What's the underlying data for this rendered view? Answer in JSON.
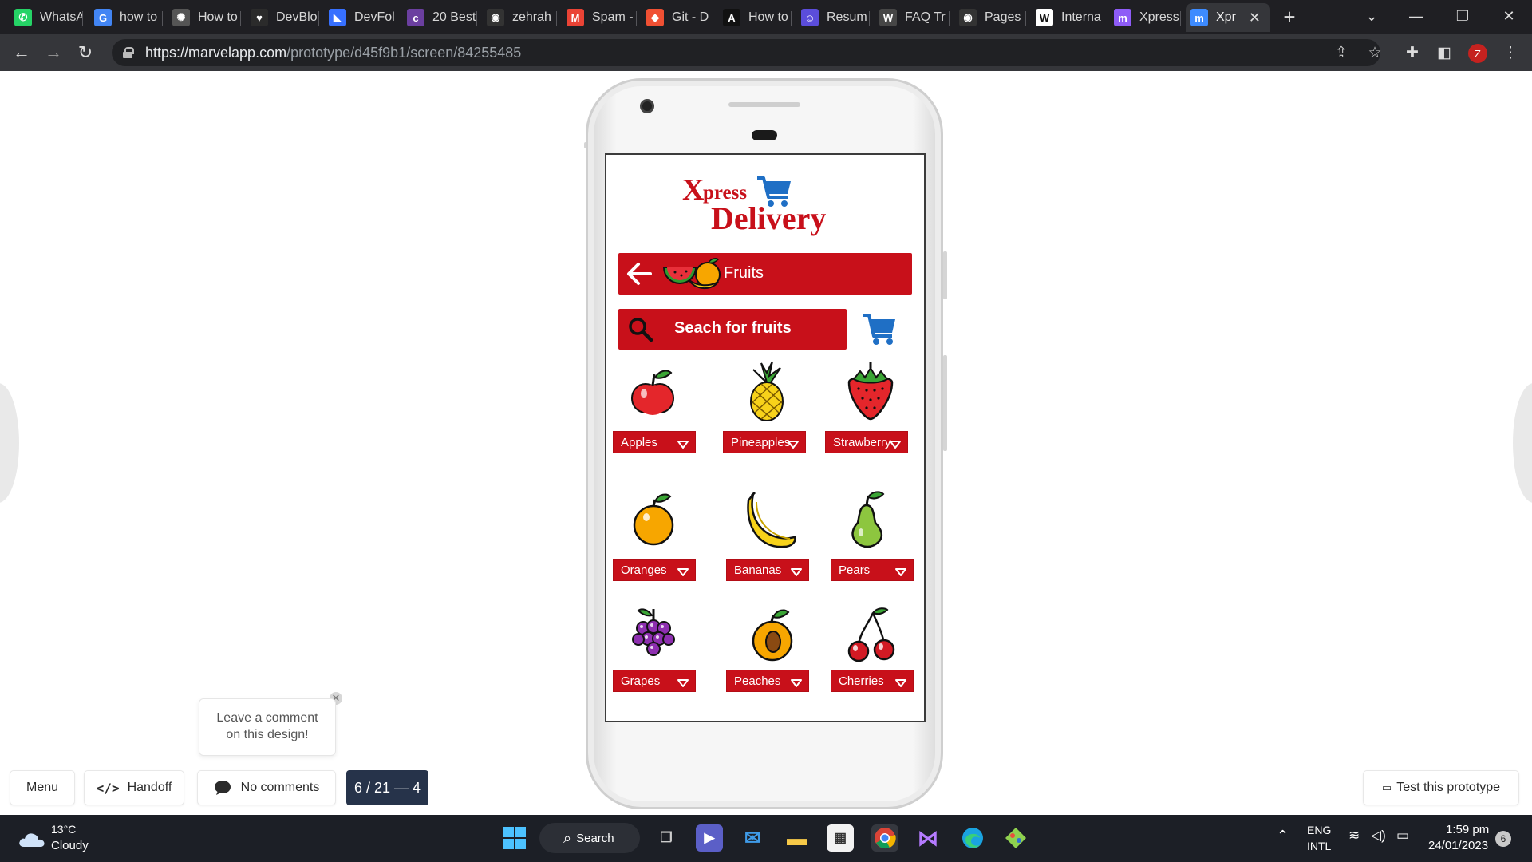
{
  "browser": {
    "tabs": [
      {
        "label": "WhatsA",
        "icon": "whatsapp-icon",
        "color": "#25d366",
        "glyph": "✆"
      },
      {
        "label": "how to",
        "icon": "google-icon",
        "color": "#4285f4",
        "glyph": "G"
      },
      {
        "label": "How to",
        "icon": "openai-icon",
        "color": "#555555",
        "glyph": "✺"
      },
      {
        "label": "DevBlo",
        "icon": "heart-icon",
        "color": "#2b2b2b",
        "glyph": "♥"
      },
      {
        "label": "DevFol",
        "icon": "devfolio-icon",
        "color": "#3770ff",
        "glyph": "◣"
      },
      {
        "label": "20 Best",
        "icon": "colorlib-icon",
        "color": "#6b3fa0",
        "glyph": "c"
      },
      {
        "label": "zehrah",
        "icon": "github-icon",
        "color": "#333333",
        "glyph": "◉"
      },
      {
        "label": "Spam -",
        "icon": "gmail-icon",
        "color": "#ea4335",
        "glyph": "M"
      },
      {
        "label": "Git - D",
        "icon": "git-icon",
        "color": "#f05033",
        "glyph": "◆"
      },
      {
        "label": "How to",
        "icon": "a-icon",
        "color": "#111111",
        "glyph": "A"
      },
      {
        "label": "Resum",
        "icon": "resume-icon",
        "color": "#5b4ddb",
        "glyph": "☺"
      },
      {
        "label": "FAQ Tr",
        "icon": "wordpress-icon",
        "color": "#464646",
        "glyph": "W"
      },
      {
        "label": "Pages",
        "icon": "github-icon",
        "color": "#333333",
        "glyph": "◉"
      },
      {
        "label": "Interna",
        "icon": "wikipedia-icon",
        "color": "#ffffff",
        "glyph": "W"
      },
      {
        "label": "Xpress",
        "icon": "marvel-icon",
        "color": "#8e5cf7",
        "glyph": "m"
      },
      {
        "label": "Xpr",
        "icon": "marvel-icon",
        "color": "#3d8bff",
        "glyph": "m"
      }
    ],
    "url_domain": "https://marvelapp.com",
    "url_path": "/prototype/d45f9b1/screen/84255485",
    "profile_initial": "Z"
  },
  "app": {
    "logo_x": "X",
    "logo_press": "press",
    "logo_delivery": "Delivery",
    "category": "Fruits",
    "search_placeholder": "Seach for fruits",
    "fruits": [
      {
        "label": "Apples",
        "icon": "apple-icon"
      },
      {
        "label": "Pineapples",
        "icon": "pineapple-icon"
      },
      {
        "label": "Strawberry",
        "icon": "strawberry-icon"
      },
      {
        "label": "Oranges",
        "icon": "orange-icon"
      },
      {
        "label": "Bananas",
        "icon": "banana-icon"
      },
      {
        "label": "Pears",
        "icon": "pear-icon"
      },
      {
        "label": "Grapes",
        "icon": "grapes-icon"
      },
      {
        "label": "Peaches",
        "icon": "peach-icon"
      },
      {
        "label": "Cherries",
        "icon": "cherries-icon"
      }
    ],
    "brand_red": "#c8101a",
    "cart_blue": "#1f6fc5"
  },
  "marvel": {
    "menu": "Menu",
    "handoff": "Handoff",
    "comments": "No comments",
    "pager": "6 / 21 — 4",
    "comment_prompt_1": "Leave a comment",
    "comment_prompt_2": "on this design!",
    "test_prototype": "Test this prototype"
  },
  "taskbar": {
    "temperature": "13°C",
    "weather": "Cloudy",
    "search": "Search",
    "lang_1": "ENG",
    "lang_2": "INTL",
    "time": "1:59 pm",
    "date": "24/01/2023",
    "notifications": "6"
  }
}
